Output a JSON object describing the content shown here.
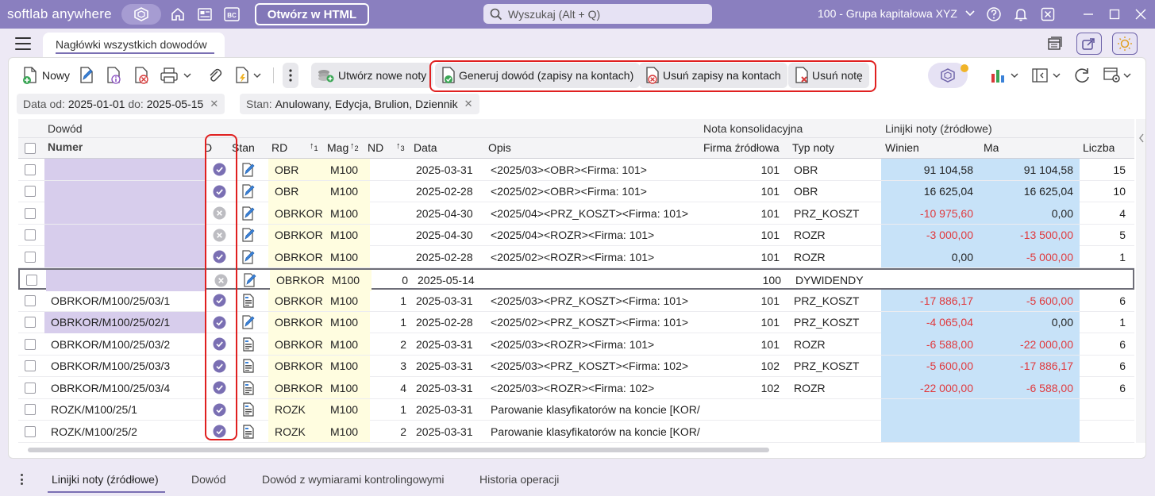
{
  "app": {
    "brand": "softlab anywhere",
    "html_button": "Otwórz w HTML",
    "search_placeholder": "Wyszukaj (Alt + Q)",
    "company": "100 - Grupa kapitałowa XYZ",
    "colors": {
      "titlebar": "#8a7fbf",
      "accent": "#7a6fb3",
      "highlight_red": "#e02020",
      "negative": "#e0393d",
      "amount_bg": "#c7e2f8",
      "code_bg": "#fffde0",
      "numer_bg": "#d7cdec"
    }
  },
  "tab": {
    "title": "Nagłówki wszystkich dowodów"
  },
  "toolbar": {
    "new": "Nowy",
    "create_notes": "Utwórz nowe noty",
    "generate": "Generuj dowód (zapisy na kontach)",
    "delete_entries": "Usuń zapisy na kontach",
    "delete_note": "Usuń notę"
  },
  "filters": {
    "date_label": "Data",
    "from_label": "od:",
    "from": "2025-01-01",
    "to_label": "do:",
    "to": "2025-05-15",
    "state_label": "Stan:",
    "state": "Anulowany, Edycja, Brulion, Dziennik"
  },
  "groups": {
    "dowod": "Dowód",
    "nota": "Nota konsolidacyjna",
    "linie": "Linijki noty (źródłowe)"
  },
  "columns": {
    "numer": "Numer",
    "d": "D",
    "stan": "Stan",
    "rd": "RD",
    "mag": "Mag",
    "nd": "ND",
    "data": "Data",
    "opis": "Opis",
    "firma": "Firma źródłowa",
    "typ": "Typ noty",
    "winien": "Winien",
    "ma": "Ma",
    "liczba": "Liczba",
    "sort1": "1",
    "sort2": "2",
    "sort3": "3"
  },
  "rows": [
    {
      "numer": "",
      "d": "ok",
      "stan": "edit",
      "rd": "OBR",
      "mag": "M100",
      "nd": "",
      "data": "2025-03-31",
      "opis": "<2025/03><OBR><Firma: 101>",
      "firma": "101",
      "typ": "OBR",
      "winien": "91 104,58",
      "ma": "91 104,58",
      "liczba": "15",
      "wneg": false,
      "mneg": false
    },
    {
      "numer": "",
      "d": "ok",
      "stan": "edit",
      "rd": "OBR",
      "mag": "M100",
      "nd": "",
      "data": "2025-02-28",
      "opis": "<2025/02><OBR><Firma: 101>",
      "firma": "101",
      "typ": "OBR",
      "winien": "16 625,04",
      "ma": "16 625,04",
      "liczba": "10",
      "wneg": false,
      "mneg": false
    },
    {
      "numer": "",
      "d": "x",
      "stan": "edit",
      "rd": "OBRKOR",
      "mag": "M100",
      "nd": "",
      "data": "2025-04-30",
      "opis": "<2025/04><PRZ_KOSZT><Firma: 101>",
      "firma": "101",
      "typ": "PRZ_KOSZT",
      "winien": "-10 975,60",
      "ma": "0,00",
      "liczba": "4",
      "wneg": true,
      "mneg": false
    },
    {
      "numer": "",
      "d": "x",
      "stan": "edit",
      "rd": "OBRKOR",
      "mag": "M100",
      "nd": "",
      "data": "2025-04-30",
      "opis": "<2025/04><ROZR><Firma: 101>",
      "firma": "101",
      "typ": "ROZR",
      "winien": "-3 000,00",
      "ma": "-13 500,00",
      "liczba": "5",
      "wneg": true,
      "mneg": true
    },
    {
      "numer": "",
      "d": "ok",
      "stan": "edit",
      "rd": "OBRKOR",
      "mag": "M100",
      "nd": "",
      "data": "2025-02-28",
      "opis": "<2025/02><ROZR><Firma: 101>",
      "firma": "101",
      "typ": "ROZR",
      "winien": "0,00",
      "ma": "-5 000,00",
      "liczba": "1",
      "wneg": false,
      "mneg": true
    },
    {
      "numer": "",
      "d": "x",
      "stan": "edit",
      "rd": "OBRKOR",
      "mag": "M100",
      "nd": "0",
      "data": "2025-05-14",
      "opis": "",
      "firma": "100",
      "typ": "DYWIDENDY",
      "winien": "",
      "ma": "",
      "liczba": "",
      "wneg": false,
      "mneg": false,
      "sel": true
    },
    {
      "numer": "OBRKOR/M100/25/03/1",
      "d": "ok",
      "stan": "doc",
      "rd": "OBRKOR",
      "mag": "M100",
      "nd": "1",
      "data": "2025-03-31",
      "opis": "<2025/03><PRZ_KOSZT><Firma: 101>",
      "firma": "101",
      "typ": "PRZ_KOSZT",
      "winien": "-17 886,17",
      "ma": "-5 600,00",
      "liczba": "6",
      "wneg": true,
      "mneg": true
    },
    {
      "numer": "OBRKOR/M100/25/02/1",
      "d": "ok",
      "stan": "edit",
      "rd": "OBRKOR",
      "mag": "M100",
      "nd": "1",
      "data": "2025-02-28",
      "opis": "<2025/02><PRZ_KOSZT><Firma: 101>",
      "firma": "101",
      "typ": "PRZ_KOSZT",
      "winien": "-4 065,04",
      "ma": "0,00",
      "liczba": "1",
      "wneg": true,
      "mneg": false,
      "purple": true
    },
    {
      "numer": "OBRKOR/M100/25/03/2",
      "d": "ok",
      "stan": "doc",
      "rd": "OBRKOR",
      "mag": "M100",
      "nd": "2",
      "data": "2025-03-31",
      "opis": "<2025/03><ROZR><Firma: 101>",
      "firma": "101",
      "typ": "ROZR",
      "winien": "-6 588,00",
      "ma": "-22 000,00",
      "liczba": "6",
      "wneg": true,
      "mneg": true
    },
    {
      "numer": "OBRKOR/M100/25/03/3",
      "d": "ok",
      "stan": "doc",
      "rd": "OBRKOR",
      "mag": "M100",
      "nd": "3",
      "data": "2025-03-31",
      "opis": "<2025/03><PRZ_KOSZT><Firma: 102>",
      "firma": "102",
      "typ": "PRZ_KOSZT",
      "winien": "-5 600,00",
      "ma": "-17 886,17",
      "liczba": "6",
      "wneg": true,
      "mneg": true
    },
    {
      "numer": "OBRKOR/M100/25/03/4",
      "d": "ok",
      "stan": "doc",
      "rd": "OBRKOR",
      "mag": "M100",
      "nd": "4",
      "data": "2025-03-31",
      "opis": "<2025/03><ROZR><Firma: 102>",
      "firma": "102",
      "typ": "ROZR",
      "winien": "-22 000,00",
      "ma": "-6 588,00",
      "liczba": "6",
      "wneg": true,
      "mneg": true
    },
    {
      "numer": "ROZK/M100/25/1",
      "d": "ok",
      "stan": "doc",
      "rd": "ROZK",
      "mag": "M100",
      "nd": "1",
      "data": "2025-03-31",
      "opis": "Parowanie klasyfikatorów na koncie [KOR/",
      "firma": "",
      "typ": "",
      "winien": "",
      "ma": "",
      "liczba": "",
      "wneg": false,
      "mneg": false
    },
    {
      "numer": "ROZK/M100/25/2",
      "d": "ok",
      "stan": "doc",
      "rd": "ROZK",
      "mag": "M100",
      "nd": "2",
      "data": "2025-03-31",
      "opis": "Parowanie klasyfikatorów na koncie [KOR/",
      "firma": "",
      "typ": "",
      "winien": "",
      "ma": "",
      "liczba": "",
      "wneg": false,
      "mneg": false
    }
  ],
  "bottom_tabs": [
    "Linijki noty (źródłowe)",
    "Dowód",
    "Dowód z wymiarami kontrolingowymi",
    "Historia operacji"
  ]
}
